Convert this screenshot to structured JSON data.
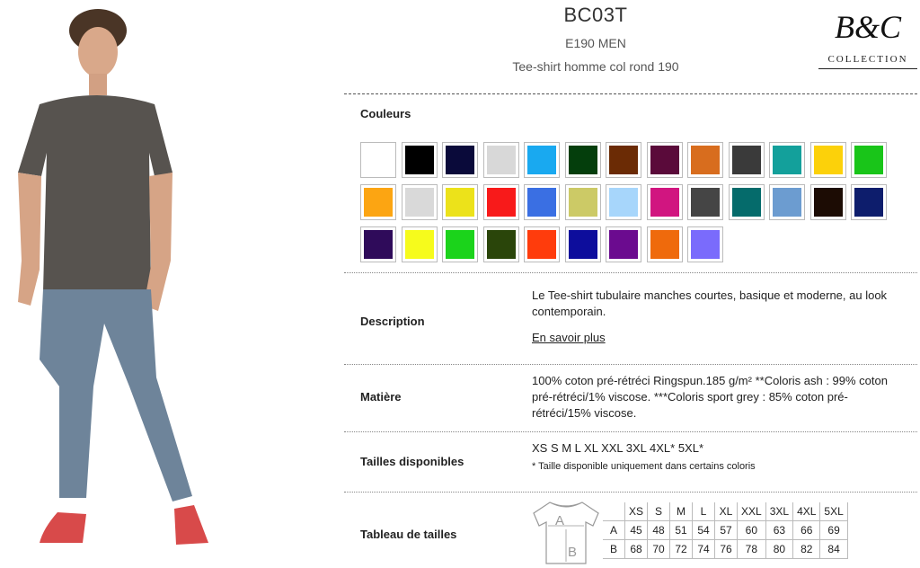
{
  "product": {
    "code": "BC03T",
    "reference": "E190 MEN",
    "name": "Tee-shirt homme col rond 190"
  },
  "brand": {
    "monogram": "B&C",
    "collection": "COLLECTION"
  },
  "colours": {
    "label": "Couleurs",
    "swatches": [
      "#ffffff",
      "#000000",
      "#0a0a3a",
      "#d8d8d8",
      "#19a9f0",
      "#043e0c",
      "#6b2b05",
      "#5a0a3a",
      "#d86d1e",
      "#3a3a3a",
      "#13a09b",
      "#fcd10a",
      "#19c519",
      "#fca512",
      "#d9d9d9",
      "#ece21a",
      "#f81a1a",
      "#3a6fe3",
      "#ccca66",
      "#a7d6fb",
      "#d11580",
      "#454545",
      "#056b6b",
      "#6c9cd0",
      "#1c0c04",
      "#0d1d6c",
      "#2f0b5a",
      "#f6fb1c",
      "#1bd31b",
      "#2a450a",
      "#ff3c0c",
      "#0d0d9c",
      "#6b0b8f",
      "#ef6a0c",
      "#7a6bfc"
    ]
  },
  "description": {
    "label": "Description",
    "text": "Le Tee-shirt tubulaire manches courtes, basique et moderne, au look contemporain.",
    "link": "En savoir plus"
  },
  "material": {
    "label": "Matière",
    "text": "100% coton pré-rétréci Ringspun.185 g/m² **Coloris ash : 99% coton pré-rétréci/1% viscose. ***Coloris sport grey : 85% coton pré-rétréci/15% viscose."
  },
  "sizes_available": {
    "label": "Tailles disponibles",
    "list": "XS S M L XL XXL 3XL 4XL* 5XL*",
    "note": "* Taille disponible uniquement dans certains coloris"
  },
  "size_table": {
    "label": "Tableau de tailles",
    "diagram_a": "A",
    "diagram_b": "B",
    "headers": [
      "XS",
      "S",
      "M",
      "L",
      "XL",
      "XXL",
      "3XL",
      "4XL",
      "5XL"
    ],
    "rows": [
      {
        "label": "A",
        "values": [
          "45",
          "48",
          "51",
          "54",
          "57",
          "60",
          "63",
          "66",
          "69"
        ]
      },
      {
        "label": "B",
        "values": [
          "68",
          "70",
          "72",
          "74",
          "76",
          "78",
          "80",
          "82",
          "84"
        ]
      }
    ]
  }
}
